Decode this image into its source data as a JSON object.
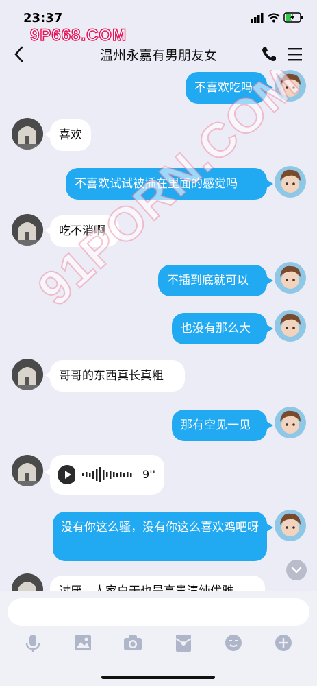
{
  "status_bar": {
    "time": "23:37"
  },
  "watermark": {
    "top_text": "9P668.COM",
    "diagonal_text": "91PORN.COM"
  },
  "nav": {
    "title": "温州永嘉有男朋友女"
  },
  "messages": [
    {
      "side": "me",
      "text": "不喜欢吃吗"
    },
    {
      "side": "them",
      "text": "喜欢"
    },
    {
      "side": "me",
      "text": "不喜欢试试被插在里面的感觉吗"
    },
    {
      "side": "them",
      "text": "吃不消啊"
    },
    {
      "side": "me",
      "text": "不插到底就可以"
    },
    {
      "side": "me",
      "text": "也没有那么大"
    },
    {
      "side": "them",
      "text": "哥哥的东西真长真粗"
    },
    {
      "side": "me",
      "text": "那有空见一见"
    },
    {
      "side": "them",
      "type": "voice",
      "duration": "9''"
    },
    {
      "side": "me",
      "text": "没有你这么骚，没有你这么喜欢鸡吧呀"
    },
    {
      "side": "them",
      "text": "讨厌，人家白天也是高贵清纯优雅"
    }
  ],
  "input": {
    "placeholder": ""
  },
  "toolbar": [
    "mic-icon",
    "image-icon",
    "camera-icon",
    "red-packet-icon",
    "emoji-icon",
    "plus-icon"
  ],
  "colors": {
    "accent": "#21AAF2",
    "background": "#ECECF6"
  }
}
